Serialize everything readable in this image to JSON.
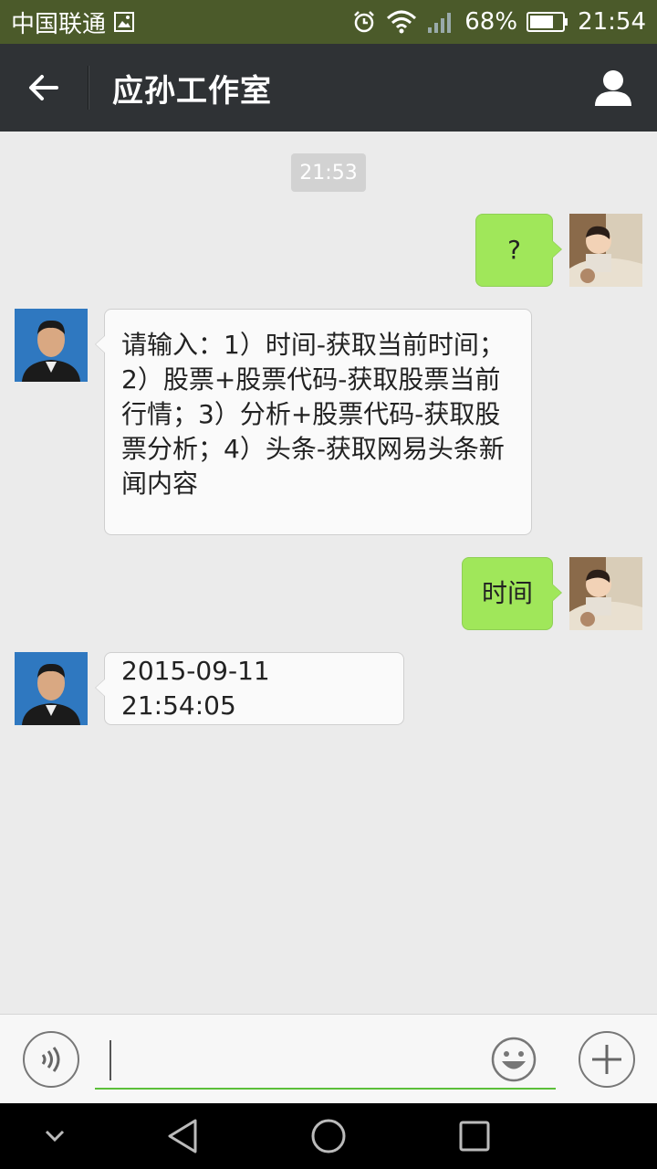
{
  "status_bar": {
    "carrier": "中国联通",
    "battery": "68%",
    "time": "21:54"
  },
  "header": {
    "title": "应孙工作室"
  },
  "chat": {
    "timestamp": "21:53",
    "messages": [
      {
        "direction": "out",
        "text": "?"
      },
      {
        "direction": "in",
        "text": "请输入：1）时间-获取当前时间；2）股票+股票代码-获取股票当前行情；3）分析+股票代码-获取股票分析；4）头条-获取网易头条新闻内容"
      },
      {
        "direction": "out",
        "text": "时间"
      },
      {
        "direction": "in",
        "text": "2015-09-11 21:54:05"
      }
    ]
  },
  "input": {
    "value": ""
  },
  "colors": {
    "status_bar": "#4b5a2a",
    "title_bar": "#2f3235",
    "outgoing_bubble": "#a0e75a",
    "incoming_bubble": "#fafafa",
    "input_underline": "#5cbf3a"
  },
  "icons": {
    "back": "arrow-left-icon",
    "profile": "person-icon",
    "voice": "voice-icon",
    "emoji": "smiley-icon",
    "more": "plus-icon"
  }
}
